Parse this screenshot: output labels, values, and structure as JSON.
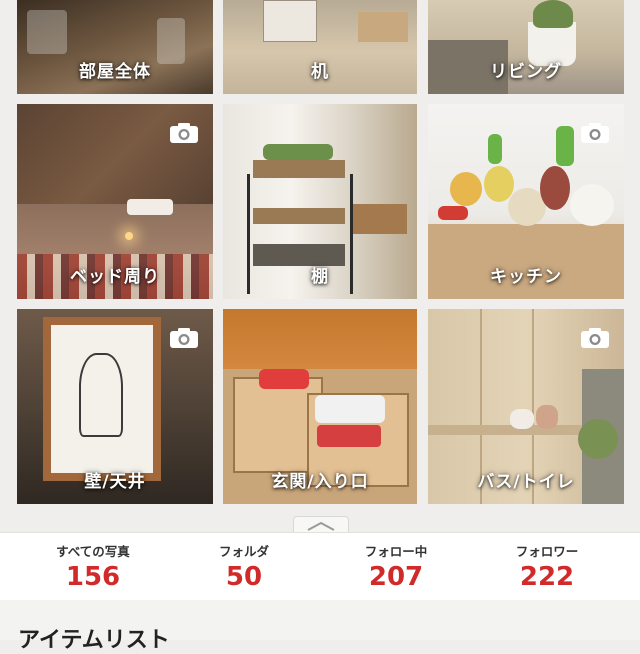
{
  "tiles": [
    {
      "label": "部屋全体",
      "camera": false
    },
    {
      "label": "机",
      "camera": false
    },
    {
      "label": "リビング",
      "camera": false
    },
    {
      "label": "ベッド周り",
      "camera": true
    },
    {
      "label": "棚",
      "camera": false
    },
    {
      "label": "キッチン",
      "camera": true
    },
    {
      "label": "壁/天井",
      "camera": true
    },
    {
      "label": "玄関/入り口",
      "camera": false
    },
    {
      "label": "バス/トイレ",
      "camera": true
    }
  ],
  "stats": [
    {
      "label": "すべての写真",
      "value": "156"
    },
    {
      "label": "フォルダ",
      "value": "50"
    },
    {
      "label": "フォロー中",
      "value": "207"
    },
    {
      "label": "フォロワー",
      "value": "222"
    }
  ],
  "section": {
    "title": "アイテムリスト"
  },
  "icons": {
    "camera": "camera-icon",
    "collapse": "chevron-up-icon"
  },
  "colors": {
    "count": "#d02a2a",
    "background": "#efeeec"
  }
}
